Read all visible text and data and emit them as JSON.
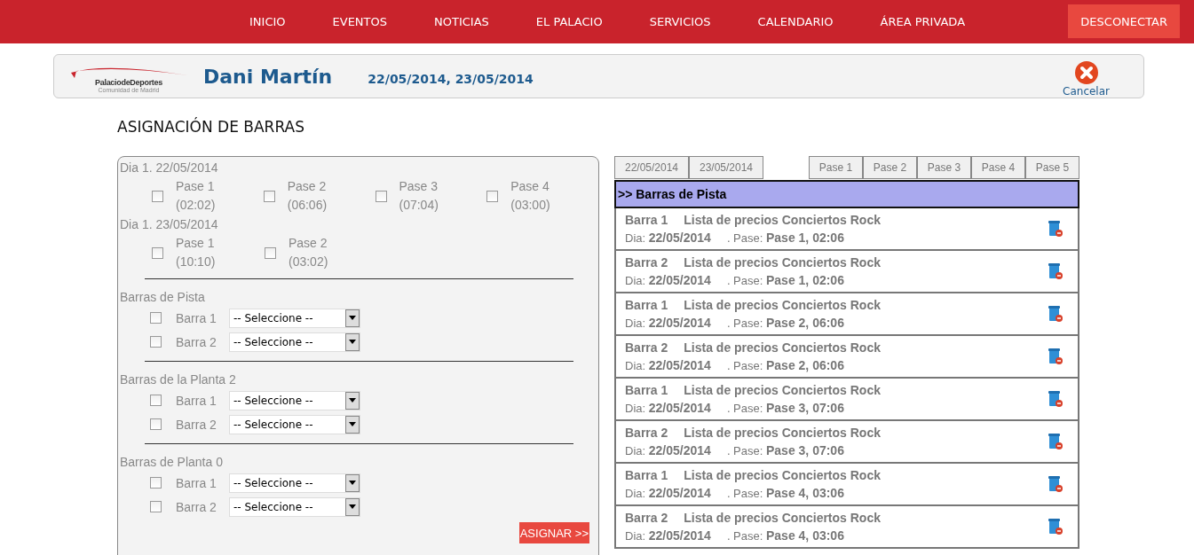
{
  "nav": {
    "items": [
      "INICIO",
      "EVENTOS",
      "NOTICIAS",
      "EL PALACIO",
      "SERVICIOS",
      "CALENDARIO",
      "ÁREA PRIVADA"
    ],
    "logout": "DESCONECTAR"
  },
  "header": {
    "logo_name": "PalaciodeDeportes",
    "logo_sub": "Comunidad de Madrid",
    "artist": "Dani Martín",
    "dates": "22/05/2014, 23/05/2014",
    "cancel": "Cancelar"
  },
  "page_title": "ASIGNACIÓN DE BARRAS",
  "days": [
    {
      "label": "Dia 1. 22/05/2014",
      "passes": [
        {
          "name": "Pase 1",
          "time": "(02:02)",
          "checked": false
        },
        {
          "name": "Pase 2",
          "time": "(06:06)",
          "checked": false
        },
        {
          "name": "Pase 3",
          "time": "(07:04)",
          "checked": false
        },
        {
          "name": "Pase 4",
          "time": "(03:00)",
          "checked": false
        }
      ]
    },
    {
      "label": "Dia 1. 23/05/2014",
      "passes": [
        {
          "name": "Pase 1",
          "time": "(10:10)",
          "checked": false
        },
        {
          "name": "Pase 2",
          "time": "(03:02)",
          "checked": false
        }
      ]
    }
  ],
  "groups": [
    {
      "label": "Barras de Pista",
      "bars": [
        {
          "name": "Barra 1",
          "checked": false,
          "value": "-- Seleccione --"
        },
        {
          "name": "Barra 2",
          "checked": false,
          "value": "-- Seleccione --"
        }
      ]
    },
    {
      "label": "Barras de la Planta 2",
      "bars": [
        {
          "name": "Barra 1",
          "checked": false,
          "value": "-- Seleccione --"
        },
        {
          "name": "Barra 2",
          "checked": false,
          "value": "-- Seleccione --"
        }
      ]
    },
    {
      "label": "Barras de Planta 0",
      "bars": [
        {
          "name": "Barra 1",
          "checked": false,
          "value": "-- Seleccione --"
        },
        {
          "name": "Barra 2",
          "checked": false,
          "value": "-- Seleccione --"
        }
      ]
    }
  ],
  "assign_button": "ASIGNAR >>",
  "date_tabs": [
    {
      "label": "22/05/2014",
      "selected": false
    },
    {
      "label": "23/05/2014",
      "selected": false
    }
  ],
  "pase_tabs": [
    {
      "label": "Pase 1",
      "selected": false
    },
    {
      "label": "Pase 2",
      "selected": false
    },
    {
      "label": "Pase 3",
      "selected": false
    },
    {
      "label": "Pase 4",
      "selected": false
    },
    {
      "label": "Pase 5",
      "selected": false
    }
  ],
  "section_title": ">> Barras de Pista",
  "assignments": [
    {
      "bar": "Barra 1",
      "list": "Lista de precios Conciertos Rock",
      "day_label": "Dia:",
      "day": "22/05/2014",
      "pase_label": ". Pase:",
      "pase": "Pase 1, 02:06"
    },
    {
      "bar": "Barra 2",
      "list": "Lista de precios Conciertos Rock",
      "day_label": "Dia:",
      "day": "22/05/2014",
      "pase_label": ". Pase:",
      "pase": "Pase 1, 02:06"
    },
    {
      "bar": "Barra 1",
      "list": "Lista de precios Conciertos Rock",
      "day_label": "Dia:",
      "day": "22/05/2014",
      "pase_label": ". Pase:",
      "pase": "Pase 2, 06:06"
    },
    {
      "bar": "Barra 2",
      "list": "Lista de precios Conciertos Rock",
      "day_label": "Dia:",
      "day": "22/05/2014",
      "pase_label": ". Pase:",
      "pase": "Pase 2, 06:06"
    },
    {
      "bar": "Barra 1",
      "list": "Lista de precios Conciertos Rock",
      "day_label": "Dia:",
      "day": "22/05/2014",
      "pase_label": ". Pase:",
      "pase": "Pase 3, 07:06"
    },
    {
      "bar": "Barra 2",
      "list": "Lista de precios Conciertos Rock",
      "day_label": "Dia:",
      "day": "22/05/2014",
      "pase_label": ". Pase:",
      "pase": "Pase 3, 07:06"
    },
    {
      "bar": "Barra 1",
      "list": "Lista de precios Conciertos Rock",
      "day_label": "Dia:",
      "day": "22/05/2014",
      "pase_label": ". Pase:",
      "pase": "Pase 4, 03:06"
    },
    {
      "bar": "Barra 2",
      "list": "Lista de precios Conciertos Rock",
      "day_label": "Dia:",
      "day": "22/05/2014",
      "pase_label": ". Pase:",
      "pase": "Pase 4, 03:06"
    }
  ]
}
